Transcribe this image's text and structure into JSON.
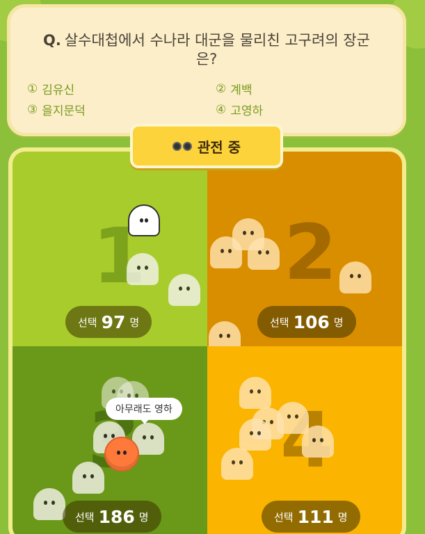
{
  "question": {
    "prefix": "Q.",
    "text": "살수대첩에서 수나라 대군을 물리친 고구려의 장군은?",
    "options": [
      {
        "num": "①",
        "label": "김유신"
      },
      {
        "num": "②",
        "label": "계백"
      },
      {
        "num": "③",
        "label": "을지문덕"
      },
      {
        "num": "④",
        "label": "고영하"
      }
    ]
  },
  "spectate": {
    "label": "관전 중",
    "icon": "binoculars-icon"
  },
  "quadrants": [
    {
      "digit": "1",
      "label": "선택",
      "count": "97",
      "unit": "명",
      "color": "#a8cc2c"
    },
    {
      "digit": "2",
      "label": "선택",
      "count": "106",
      "unit": "명",
      "color": "#d98e00"
    },
    {
      "digit": "3",
      "label": "선택",
      "count": "186",
      "unit": "명",
      "color": "#6a9818"
    },
    {
      "digit": "4",
      "label": "선택",
      "count": "111",
      "unit": "명",
      "color": "#fbb400"
    }
  ],
  "speech_bubble": {
    "text": "아무래도 영하"
  }
}
